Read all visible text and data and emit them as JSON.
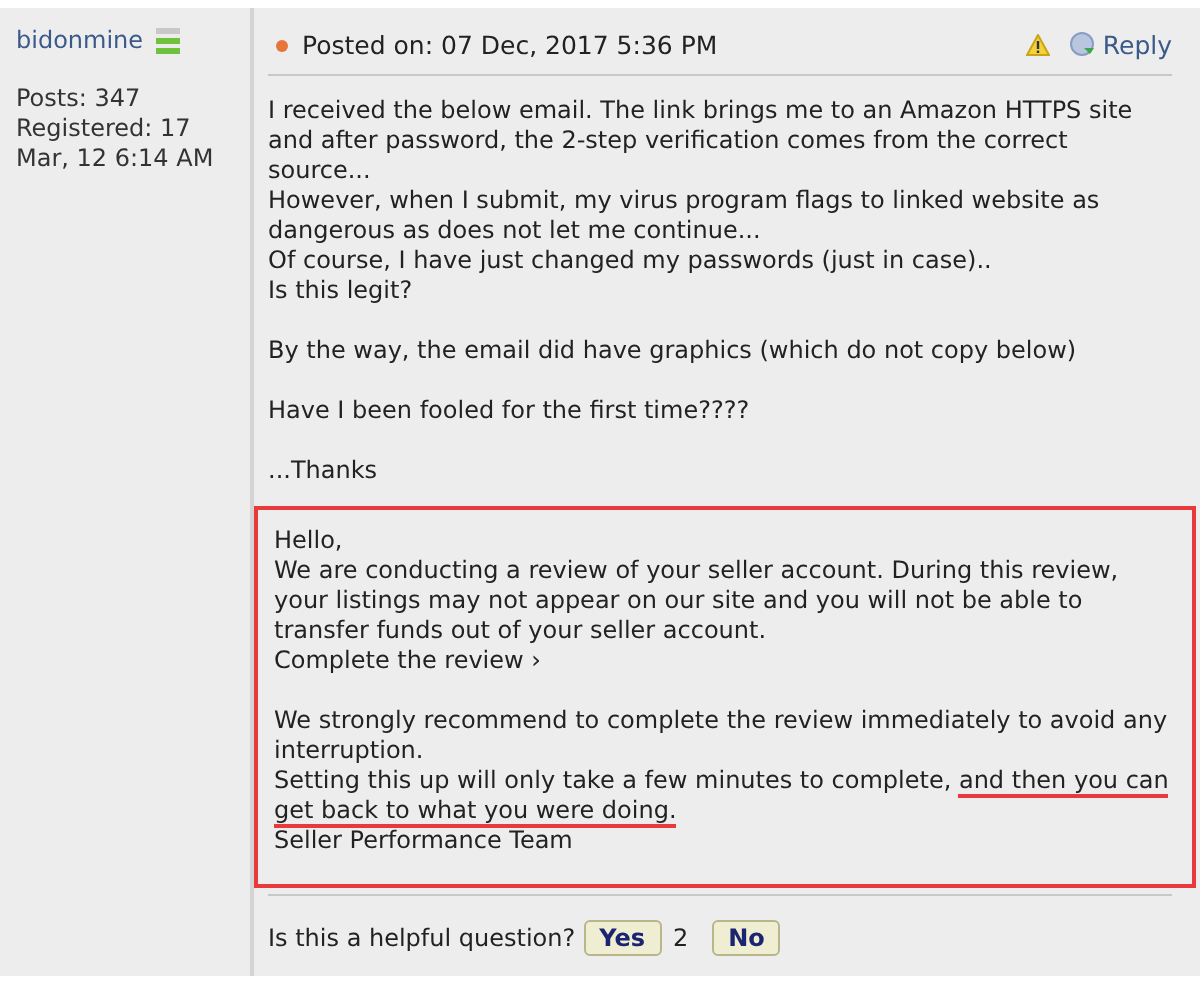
{
  "author": {
    "name": "bidonmine",
    "posts": "Posts: 347",
    "registered": "Registered: 17 Mar, 12 6:14 AM"
  },
  "post": {
    "posted": "Posted on: 07 Dec, 2017 5:36 PM",
    "reply": "Reply",
    "body": [
      [
        "I received the below email. The link brings me to an Amazon HTTPS site and after password, the 2-step verification comes from the correct source...",
        "However, when I submit, my virus program flags to linked website as dangerous as does not let me continue...",
        "Of course, I have just changed my passwords (just in case)..",
        "Is this legit?"
      ],
      [
        "By the way, the email did have graphics (which do not copy below)"
      ],
      [
        "Have I been fooled for the first time????"
      ],
      [
        "...Thanks"
      ]
    ],
    "quoted_email": {
      "highlighted": true,
      "blocks": [
        [
          [
            {
              "text": "Hello,",
              "underlined": false
            }
          ],
          [
            {
              "text": "We are conducting a review of your seller account. During this review, your listings may not appear on our site and you will not be able to transfer funds out of your seller account.",
              "underlined": false
            }
          ],
          [
            {
              "text": "Complete the review ›",
              "underlined": false
            }
          ]
        ],
        [
          [
            {
              "text": "We strongly recommend to complete the review immediately to avoid any interruption.",
              "underlined": false
            }
          ],
          [
            {
              "text": "Setting this up will only take a few minutes to complete, ",
              "underlined": false
            },
            {
              "text": "and then you can get back to what you were doing.",
              "underlined": true
            }
          ],
          [
            {
              "text": "Seller Performance Team",
              "underlined": false
            }
          ]
        ]
      ]
    },
    "helpful": {
      "question": "Is this a helpful question?",
      "yes": "Yes",
      "count": "2",
      "no": "No"
    }
  }
}
